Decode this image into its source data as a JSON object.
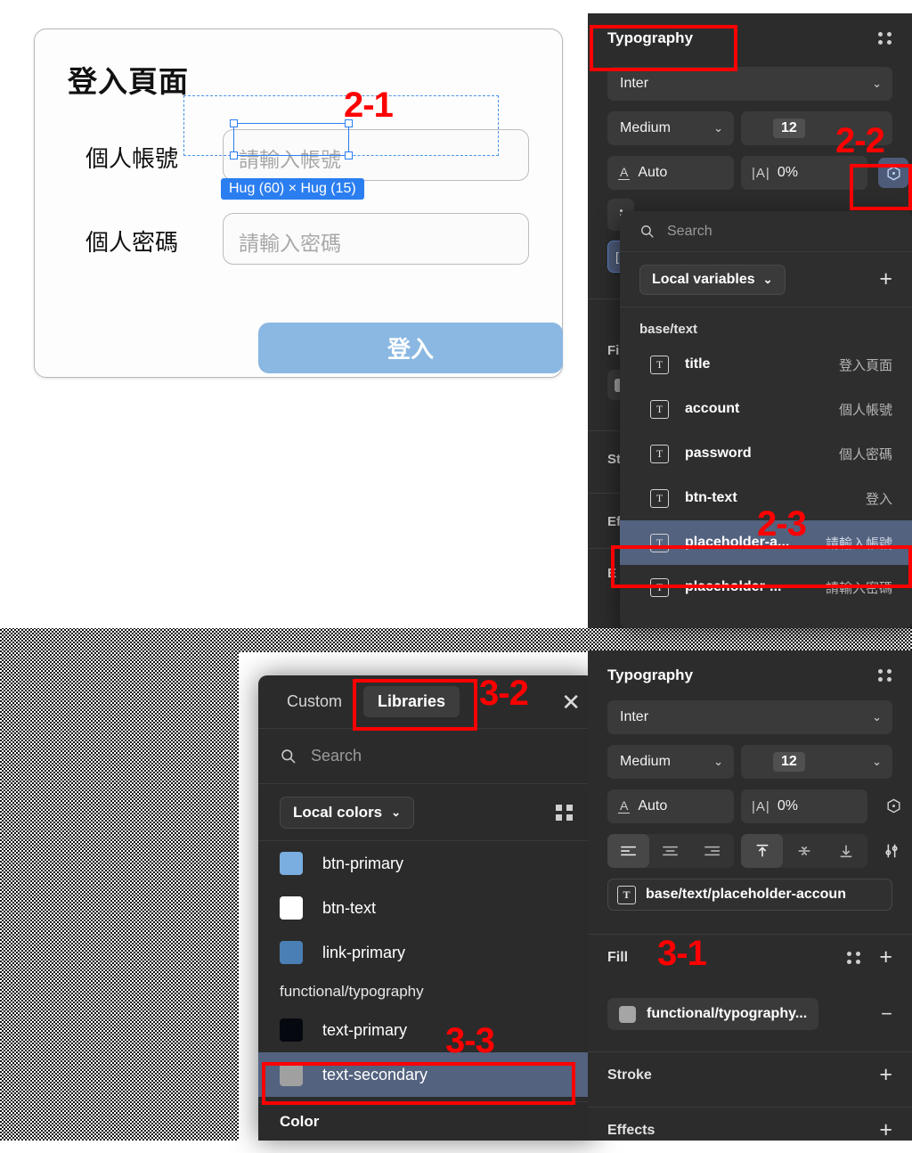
{
  "login_mock": {
    "title": "登入頁面",
    "account_label": "個人帳號",
    "password_label": "個人密碼",
    "account_placeholder": "請輸入帳號",
    "password_placeholder": "請輸入密碼",
    "size_badge": "Hug (60) × Hug (15)",
    "submit_label": "登入",
    "button_color": "#8ab8e2"
  },
  "annotations": {
    "a2_1": "2-1",
    "a2_2": "2-2",
    "a2_3": "2-3",
    "a3_1": "3-1",
    "a3_2": "3-2",
    "a3_3": "3-3",
    "color": "#ff0000"
  },
  "typography_top": {
    "header": "Typography",
    "font_family": "Inter",
    "font_weight": "Medium",
    "font_size": "12",
    "line_height": "Auto",
    "letter_spacing": "0%",
    "chevron": "⌄"
  },
  "ghost_sections": {
    "fill": "Fi",
    "stroke": "St",
    "effects": "Ef",
    "export": "E"
  },
  "variables_popover": {
    "search_placeholder": "Search",
    "scope_label": "Local variables",
    "add_label": "+",
    "group": "base/text",
    "rows": [
      {
        "icon": "text-variable-icon",
        "name": "title",
        "value": "登入頁面",
        "selected": false
      },
      {
        "icon": "text-variable-icon",
        "name": "account",
        "value": "個人帳號",
        "selected": false
      },
      {
        "icon": "text-variable-icon",
        "name": "password",
        "value": "個人密碼",
        "selected": false
      },
      {
        "icon": "text-variable-icon",
        "name": "btn-text",
        "value": "登入",
        "selected": false
      },
      {
        "icon": "text-variable-icon",
        "name": "placeholder-a...",
        "value": "請輸入帳號",
        "selected": true
      },
      {
        "icon": "text-variable-icon",
        "name": "placeholder-...",
        "value": "請輸入密碼",
        "selected": false
      }
    ]
  },
  "libraries_dialog": {
    "tab_custom": "Custom",
    "tab_libraries": "Libraries",
    "close_label": "✕",
    "search_placeholder": "Search",
    "scope_label": "Local colors",
    "footer_label": "Color",
    "colors": [
      {
        "name": "btn-primary",
        "hex": "#7aaee0",
        "selected": false
      },
      {
        "name": "btn-text",
        "hex": "#ffffff",
        "selected": false
      },
      {
        "name": "link-primary",
        "hex": "#4a7fb5",
        "selected": false
      }
    ],
    "group_title": "functional/typography",
    "group_colors": [
      {
        "name": "text-primary",
        "hex": "#05080f",
        "selected": false
      },
      {
        "name": "text-secondary",
        "hex": "#a0a0a0",
        "selected": true
      }
    ]
  },
  "typography_bottom": {
    "header": "Typography",
    "font_family": "Inter",
    "font_weight": "Medium",
    "font_size": "12",
    "line_height": "Auto",
    "letter_spacing": "0%",
    "style_chip": "base/text/placeholder-accoun",
    "fill_label": "Fill",
    "fill_value": "functional/typography...",
    "stroke_label": "Stroke",
    "effects_label": "Effects",
    "add_label": "+",
    "remove_label": "−"
  }
}
